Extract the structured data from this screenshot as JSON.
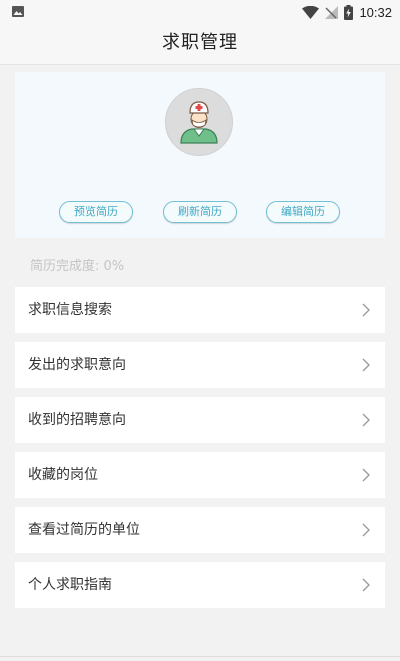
{
  "status_bar": {
    "time": "10:32",
    "icons": [
      "image-icon",
      "wifi-icon",
      "signal-off-icon",
      "battery-charging-icon"
    ]
  },
  "header": {
    "title": "求职管理"
  },
  "profile": {
    "avatar_icon": "doctor-avatar-icon",
    "buttons": [
      {
        "label": "预览简历"
      },
      {
        "label": "刷新简历"
      },
      {
        "label": "编辑简历"
      }
    ],
    "completion_text": "简历完成度: 0%"
  },
  "menu": {
    "items": [
      {
        "label": "求职信息搜索"
      },
      {
        "label": "发出的求职意向"
      },
      {
        "label": "收到的招聘意向"
      },
      {
        "label": "收藏的岗位"
      },
      {
        "label": "查看过简历的单位"
      },
      {
        "label": "个人求职指南"
      }
    ]
  },
  "colors": {
    "accent": "#3fa8c4",
    "card_bg": "#f4f9fd",
    "page_bg": "#f2f2f2"
  }
}
